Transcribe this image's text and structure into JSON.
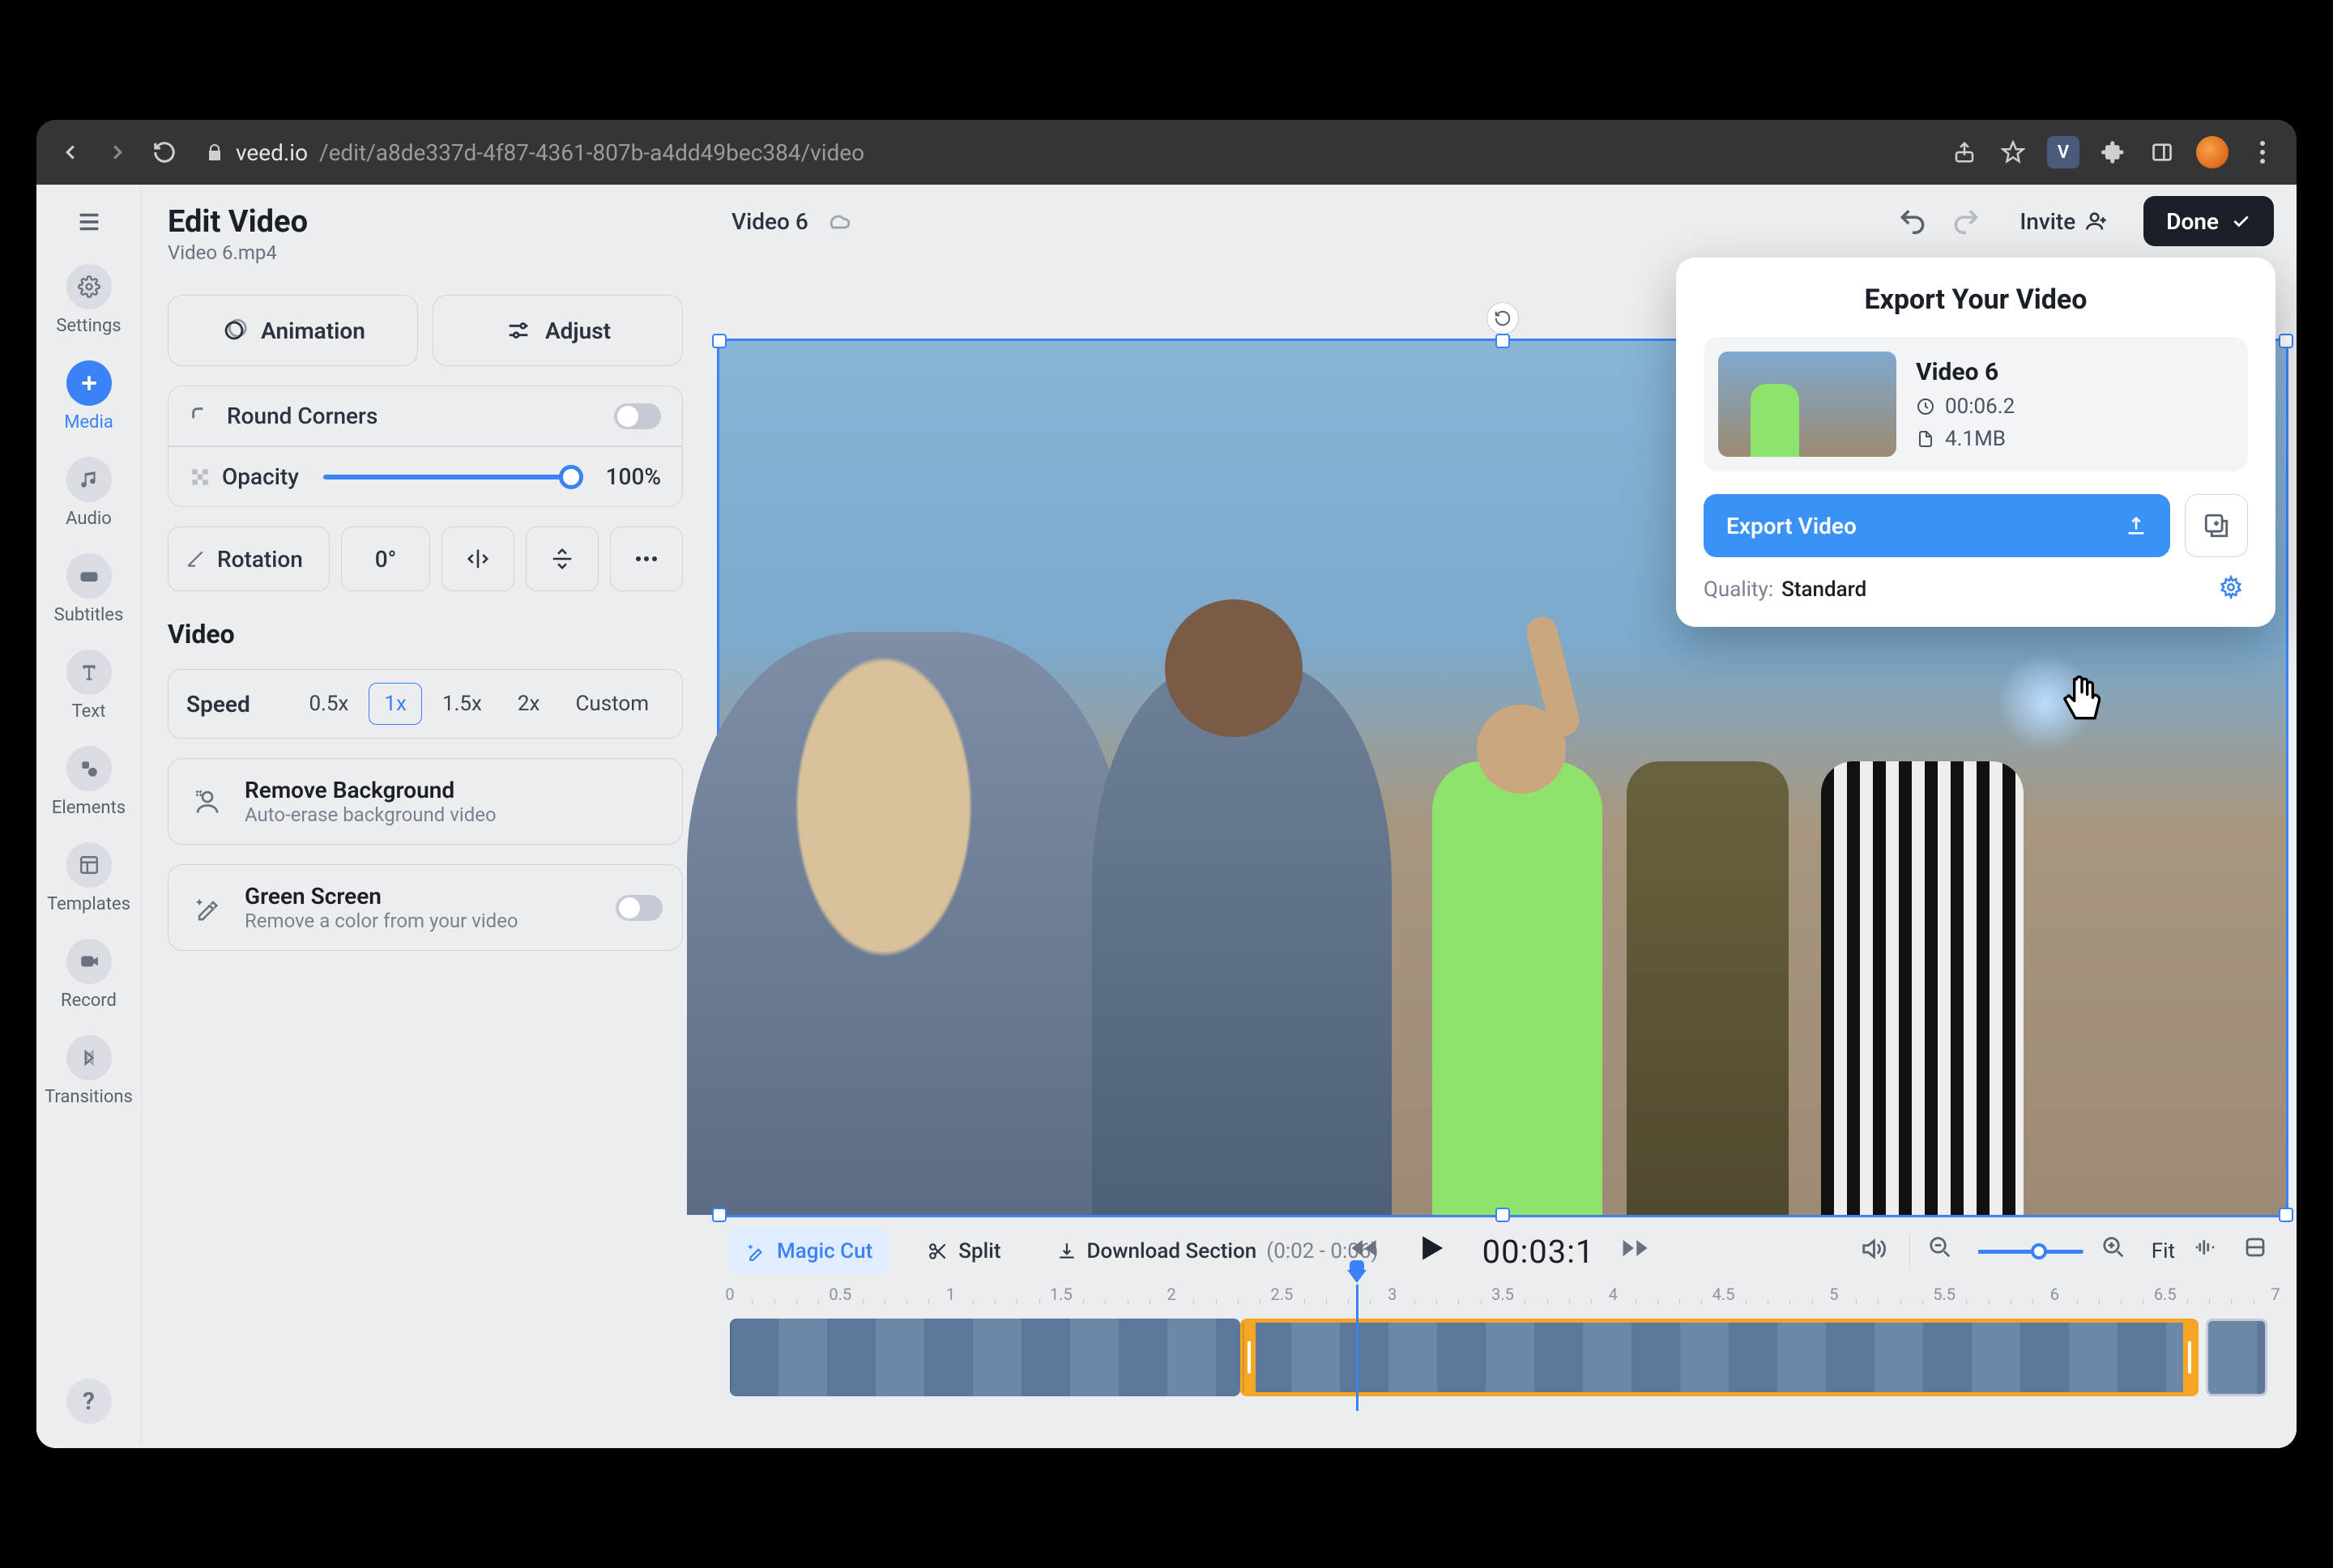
{
  "browser": {
    "url_domain": "veed.io",
    "url_path": "/edit/a8de337d-4f87-4361-807b-a4dd49bec384/video",
    "ext_badge": "V"
  },
  "leftnav": {
    "items": [
      {
        "label": "Settings"
      },
      {
        "label": "Media"
      },
      {
        "label": "Audio"
      },
      {
        "label": "Subtitles"
      },
      {
        "label": "Text"
      },
      {
        "label": "Elements"
      },
      {
        "label": "Templates"
      },
      {
        "label": "Record"
      },
      {
        "label": "Transitions"
      }
    ],
    "help": "?"
  },
  "props": {
    "title": "Edit Video",
    "filename": "Video 6.mp4",
    "buttons": {
      "animation": "Animation",
      "adjust": "Adjust"
    },
    "round_corners": "Round Corners",
    "opacity_label": "Opacity",
    "opacity_value": "100%",
    "rotation_label": "Rotation",
    "rotation_value": "0°",
    "video_section": "Video",
    "speed_label": "Speed",
    "speeds": [
      "0.5x",
      "1x",
      "1.5x",
      "2x",
      "Custom"
    ],
    "remove_bg_title": "Remove Background",
    "remove_bg_sub": "Auto-erase background video",
    "green_title": "Green Screen",
    "green_sub": "Remove a color from your video"
  },
  "topbar": {
    "project": "Video 6",
    "invite": "Invite",
    "done": "Done"
  },
  "export": {
    "title": "Export Your Video",
    "video_name": "Video 6",
    "duration": "00:06.2",
    "size": "4.1MB",
    "btn": "Export Video",
    "quality_label": "Quality:",
    "quality_value": "Standard"
  },
  "timeline": {
    "magic": "Magic Cut",
    "split": "Split",
    "download": "Download Section",
    "range": "(0:02 - 0:06)",
    "time": "00:03:1",
    "fit": "Fit",
    "ruler": [
      "0",
      "0.5",
      "1",
      "1.5",
      "2",
      "2.5",
      "3",
      "3.5",
      "4",
      "4.5",
      "5",
      "5.5",
      "6",
      "6.5",
      "7"
    ]
  }
}
